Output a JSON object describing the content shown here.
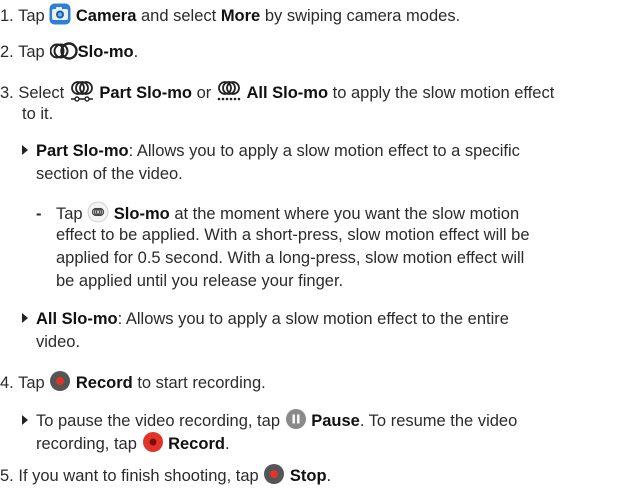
{
  "steps": {
    "s1": {
      "num": "1.",
      "tap": "Tap",
      "camera": "Camera",
      "mid": "and select",
      "more": "More",
      "end": "by swiping camera modes."
    },
    "s2": {
      "num": "2.",
      "tap": "Tap",
      "slomo": "Slo-mo",
      "end": "."
    },
    "s3": {
      "num": "3.",
      "select": "Select",
      "part": "Part Slo-mo",
      "or": "or",
      "all": "All Slo-mo",
      "end1": "to apply the slow motion effect",
      "line2": "to it."
    },
    "b1": {
      "label": "Part Slo-mo",
      "l1": ": Allows you to apply a slow motion effect to a specific",
      "l2": "section of the video."
    },
    "d1": {
      "dash": "-",
      "tap": "Tap",
      "slomo": "Slo-mo",
      "l1": "at the moment where you want the slow motion",
      "l2": "effect to be applied. With a short-press, slow motion effect will be",
      "l3": "applied for 0.5 second. With a long-press, slow motion effect will",
      "l4": "be applied until you release your finger."
    },
    "b2": {
      "label": "All Slo-mo",
      "l1": ": Allows you to apply a slow motion effect to the entire",
      "l2": "video."
    },
    "s4": {
      "num": "4.",
      "tap": "Tap",
      "record": "Record",
      "end": "to start recording."
    },
    "b3": {
      "l1a": "To pause the video recording, tap",
      "pause": "Pause",
      "l1b": ". To resume the video",
      "l2a": "recording, tap",
      "record": "Record",
      "l2b": "."
    },
    "s5": {
      "num": "5.",
      "a": "If you want to finish shooting, tap",
      "stop": "Stop",
      "end": "."
    }
  },
  "icons": {
    "camera": "camera-app-icon",
    "slomo_mode": "slo-mo-mode-icon",
    "part_slomo": "part-slo-mo-icon",
    "all_slomo": "all-slo-mo-icon",
    "slomo_button": "slo-mo-button-icon",
    "record": "record-button-icon",
    "pause": "pause-button-icon",
    "stop": "stop-button-icon"
  },
  "colors": {
    "accent_blue": "#2f7fd6",
    "record_red": "#e0342b",
    "pause_gray": "#8a8a8a",
    "dark_button": "#555555"
  }
}
